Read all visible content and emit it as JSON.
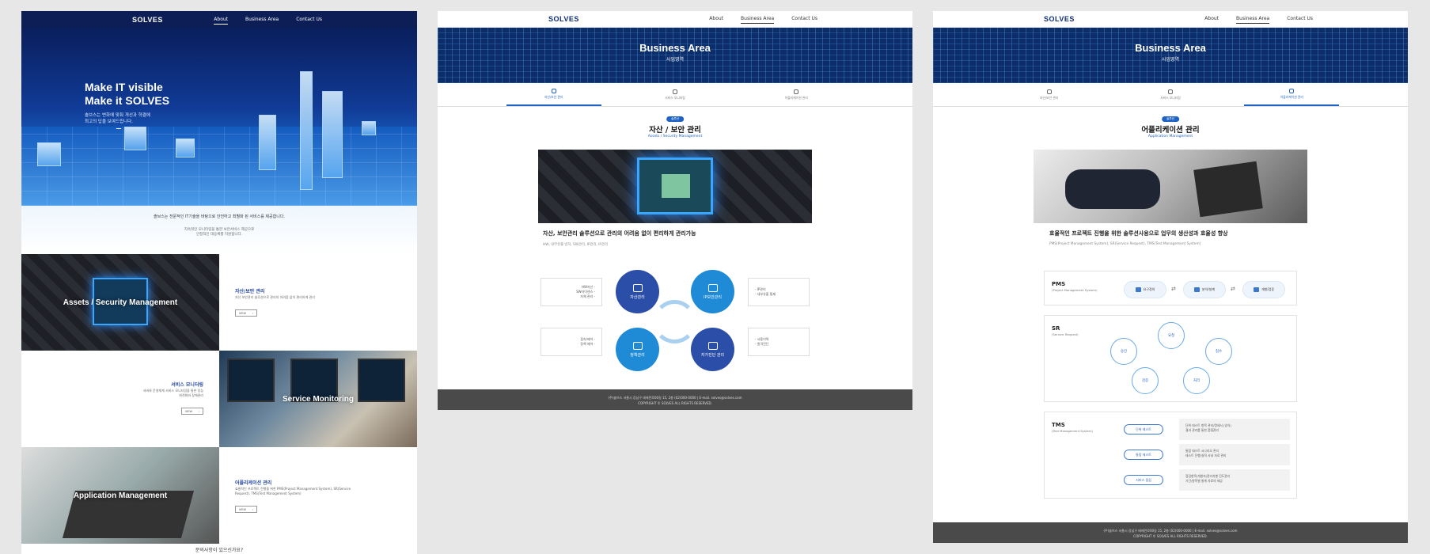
{
  "logo": "SOLVES",
  "nav": [
    "About",
    "Business Area",
    "Contact Us"
  ],
  "home": {
    "hero_line1": "Make IT visible",
    "hero_line2": "Make it SOLVES",
    "hero_desc1": "솔브스는 변화에 맞춰 개선과 혁결에",
    "hero_desc2": "최고의 답을 보여드립니다.",
    "intro_main": "솔브스는 전문적인 IT기술을 바탕으로 안전하고 최별화 된 서비스를 제공합니다.",
    "intro_sub1": "지속적인 모니터링을 통한 보안서비스 제공으로",
    "intro_sub2": "안정적인 대응체를 지원합니다.",
    "tiles": [
      {
        "overlay": "Assets / Security Management",
        "title": "자산/보안 관리",
        "desc": "자산 보안관리 솔루션으로 관리의 어려움 없이 편리하게 관리",
        "btn": "VIEW"
      },
      {
        "overlay": "Service Monitoring",
        "title": "서비스 모니터링",
        "desc": "서버와 운영체계 서비스 모니터링을 통한 장능 최적화와 장애관리",
        "btn": "VIEW"
      },
      {
        "overlay": "Application Management",
        "title": "어플리케이션 관리",
        "desc": "효율적인 프로젝트 진행을 위한 PMS(Project Management System), SR(Service Request), TMS(Test Management System)",
        "btn": "VIEW"
      }
    ],
    "bottom_question": "문의사항이 있으신가요?"
  },
  "business": {
    "banner_title": "Business Area",
    "banner_sub": "사업영역",
    "tabs": [
      "자산/보안 관리",
      "서비스 모니터링",
      "어플리케이션 관리"
    ],
    "solution_pill": "솔루션",
    "footer_line1": "(주)솔브스  서울시 강남구 테헤란로00길 15, 2층 (02)000-0000   |   E-mail. solves@solves.com",
    "footer_line2": "COPYRIGHT © SOLVES ALL RIGHTS RESERVED."
  },
  "security": {
    "title": "자산 / 보안 관리",
    "subtitle": "Assets / Security Management",
    "lead": "자산, 보안관리 솔루션으로 관리의 어려움 없이 편리하게 관리가능",
    "tags": "HW, 내부유출 방지, SW관리, IP관리, IP관리",
    "left_top": [
      "HW자산 -",
      "SW라이센스 -",
      "자체 관리 -"
    ],
    "left_bottom": [
      "접속/제어 -",
      "정책 제어 -"
    ],
    "right_top": [
      "- IP관리",
      "- 내부유출 통제"
    ],
    "right_bottom": [
      "- 사용이력",
      "- 원격진단"
    ],
    "circles": [
      "자산관리",
      "IP보안관리",
      "정책관리",
      "자가진단 관리"
    ],
    "colors": {
      "dark_circle": "#2b4ea8",
      "light_circle": "#1f8ad6"
    }
  },
  "application": {
    "title": "어플리케이션 관리",
    "subtitle": "Application Management",
    "lead": "효율적인 프로젝트 진행을 위한 솔루션사용으로 업무의 생산성과 효율성 향상",
    "tags": "PMS(Project Management System), SR(Service Request), TMS(Test Management System)",
    "pms": {
      "title": "PMS",
      "sub": "(Project Management System)",
      "steps": [
        "요구정의",
        "분석/설계",
        "개발/검증"
      ]
    },
    "sr": {
      "title": "SR",
      "sub": "(Service Request)",
      "nodes": [
        "요청",
        "접수",
        "처리",
        "검증",
        "승인"
      ]
    },
    "tms": {
      "title": "TMS",
      "sub": "(Test Management System)",
      "rows": [
        {
          "tag": "단위 테스트",
          "desc1": "단위 테스트 항목 관리/명세서 (양식)",
          "desc2": "결과 관리를 통한 품질관리"
        },
        {
          "tag": "통합 테스트",
          "desc1": "통합 테스트 시나리오 관리",
          "desc2": "테스트 진행/실적 사내 자료 관리"
        },
        {
          "tag": "서비스 점검",
          "desc1": "점검항목/개발자/관리자별 진도관리",
          "desc2": "기간/항목별 통계 자료의 제공"
        }
      ]
    }
  }
}
